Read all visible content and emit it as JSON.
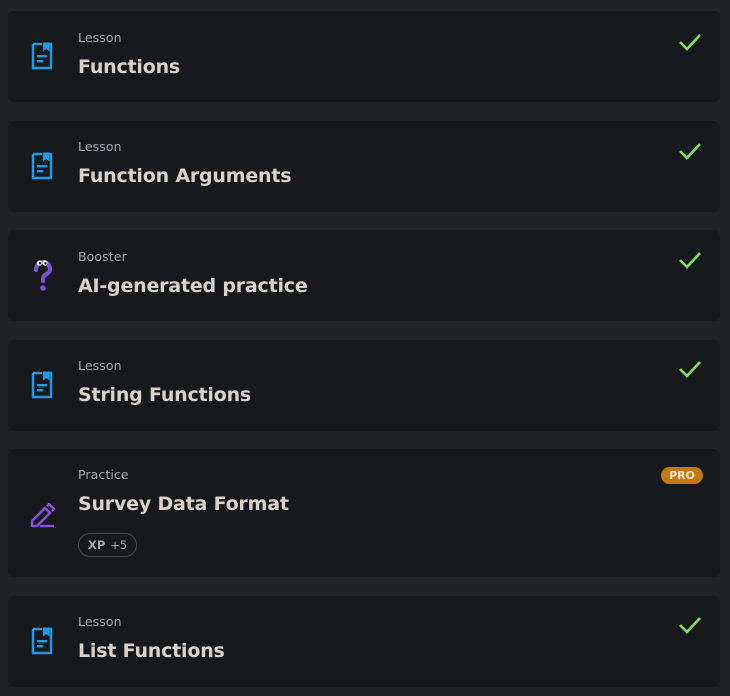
{
  "items": [
    {
      "type": "Lesson",
      "title": "Functions",
      "completed": true,
      "icon": "lesson-icon"
    },
    {
      "type": "Lesson",
      "title": "Function Arguments",
      "completed": true,
      "icon": "lesson-icon"
    },
    {
      "type": "Booster",
      "title": "AI-generated practice",
      "completed": true,
      "icon": "booster-question-icon"
    },
    {
      "type": "Lesson",
      "title": "String Functions",
      "completed": true,
      "icon": "lesson-icon"
    },
    {
      "type": "Practice",
      "title": "Survey Data Format",
      "completed": false,
      "icon": "practice-pencil-icon",
      "badge": "PRO",
      "xp_label": "XP",
      "xp_value": "+5"
    },
    {
      "type": "Lesson",
      "title": "List Functions",
      "completed": true,
      "icon": "lesson-icon"
    }
  ],
  "colors": {
    "background": "#222326",
    "card": "#18191c",
    "lesson_icon": "#1e9be8",
    "booster_icon": "#7c52d8",
    "practice_icon": "#8a52e0",
    "check": "#7ee05f",
    "pro_badge": "#c27a10"
  }
}
